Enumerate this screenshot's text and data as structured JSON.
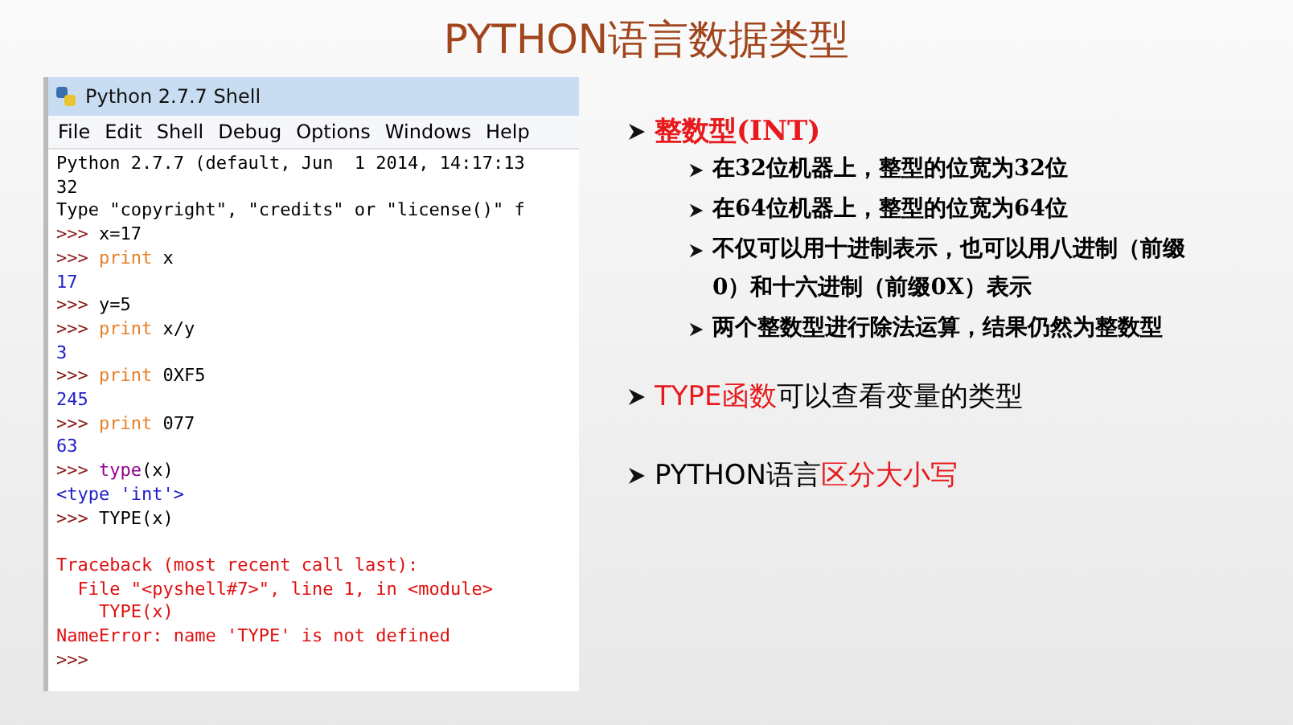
{
  "slide_title": "PYTHON语言数据类型",
  "shell": {
    "title": "Python 2.7.7 Shell",
    "menu": [
      "File",
      "Edit",
      "Shell",
      "Debug",
      "Options",
      "Windows",
      "Help"
    ],
    "lines": [
      [
        {
          "text": "Python 2.7.7 (default, Jun  1 2014, 14:17:13",
          "kind": "plain"
        }
      ],
      [
        {
          "text": "32",
          "kind": "plain"
        }
      ],
      [
        {
          "text": "Type \"copyright\", \"credits\" or \"license()\" f",
          "kind": "plain"
        }
      ],
      [
        {
          "text": ">>> ",
          "kind": "prompt"
        },
        {
          "text": "x=17",
          "kind": "plain"
        }
      ],
      [
        {
          "text": ">>> ",
          "kind": "prompt"
        },
        {
          "text": "print",
          "kind": "keyword"
        },
        {
          "text": " x",
          "kind": "plain"
        }
      ],
      [
        {
          "text": "17",
          "kind": "output"
        }
      ],
      [
        {
          "text": ">>> ",
          "kind": "prompt"
        },
        {
          "text": "y=5",
          "kind": "plain"
        }
      ],
      [
        {
          "text": ">>> ",
          "kind": "prompt"
        },
        {
          "text": "print",
          "kind": "keyword"
        },
        {
          "text": " x/y",
          "kind": "plain"
        }
      ],
      [
        {
          "text": "3",
          "kind": "output"
        }
      ],
      [
        {
          "text": ">>> ",
          "kind": "prompt"
        },
        {
          "text": "print",
          "kind": "keyword"
        },
        {
          "text": " 0XF5",
          "kind": "plain"
        }
      ],
      [
        {
          "text": "245",
          "kind": "output"
        }
      ],
      [
        {
          "text": ">>> ",
          "kind": "prompt"
        },
        {
          "text": "print",
          "kind": "keyword"
        },
        {
          "text": " 077",
          "kind": "plain"
        }
      ],
      [
        {
          "text": "63",
          "kind": "output"
        }
      ],
      [
        {
          "text": ">>> ",
          "kind": "prompt"
        },
        {
          "text": "type",
          "kind": "builtin"
        },
        {
          "text": "(x)",
          "kind": "plain"
        }
      ],
      [
        {
          "text": "<type 'int'>",
          "kind": "output"
        }
      ],
      [
        {
          "text": ">>> ",
          "kind": "prompt"
        },
        {
          "text": "TYPE(x)",
          "kind": "plain"
        }
      ],
      [
        {
          "text": "Traceback (most recent call last):",
          "kind": "error",
          "gap_before": true
        }
      ],
      [
        {
          "text": "  File \"<pyshell#7>\", line 1, in <module>",
          "kind": "error"
        }
      ],
      [
        {
          "text": "    TYPE(x)",
          "kind": "error"
        }
      ],
      [
        {
          "text": "NameError: name 'TYPE' is not defined",
          "kind": "error"
        }
      ],
      [
        {
          "text": ">>>",
          "kind": "prompt"
        }
      ]
    ]
  },
  "points": [
    {
      "parts": [
        {
          "text": "整数型(INT)",
          "emphasis": true
        }
      ],
      "children": [
        {
          "parts": [
            {
              "text": "在32位机器上，整型的位宽为32位",
              "emphasis": false
            }
          ]
        },
        {
          "parts": [
            {
              "text": "在64位机器上，整型的位宽为64位",
              "emphasis": false
            }
          ]
        },
        {
          "parts": [
            {
              "text": "不仅可以用十进制表示，也可以用八进制（前缀0）和十六进制（前缀0X）表示",
              "emphasis": false
            }
          ]
        },
        {
          "parts": [
            {
              "text": "两个整数型进行除法运算，结果仍然为整数型",
              "emphasis": false
            }
          ]
        }
      ]
    },
    {
      "parts": [
        {
          "text": "TYPE函数",
          "emphasis": true
        },
        {
          "text": "可以查看变量的类型",
          "emphasis": false
        }
      ]
    },
    {
      "parts": [
        {
          "text": "PYTHON语言",
          "emphasis": false
        },
        {
          "text": "区分大小写",
          "emphasis": true
        }
      ]
    }
  ]
}
